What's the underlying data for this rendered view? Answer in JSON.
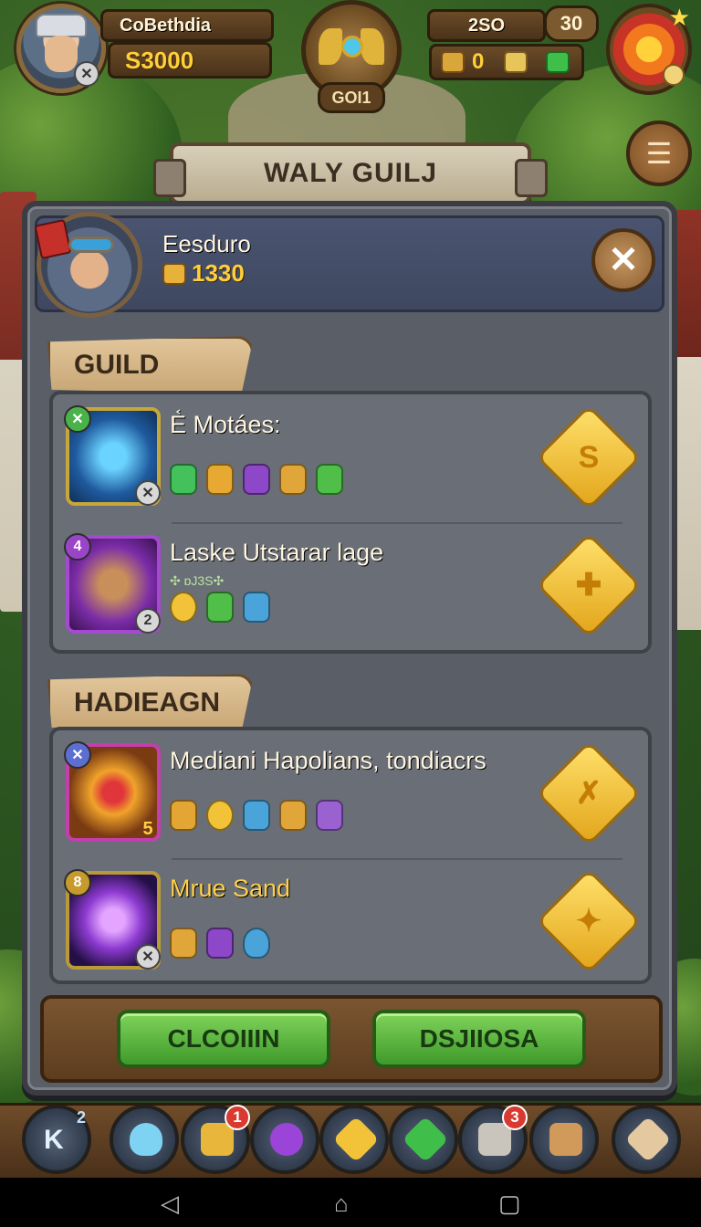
{
  "hud": {
    "player_name": "CoBethdia",
    "coins": "S3000",
    "emblem_label": "GOI1",
    "resource_top": "2SO",
    "resource_bottom": "0",
    "level": "30",
    "avatar_mini": "✕"
  },
  "title": "WALY GUILJ",
  "player": {
    "name": "Eesduro",
    "coins": "1330",
    "close_icon": "✕"
  },
  "sections": [
    {
      "tag": "GUILD",
      "rows": [
        {
          "title": "E᷾ Motáes:",
          "subtitle": "",
          "badge": "✕",
          "level": "✕",
          "button_glyph": "S",
          "items": [
            "#44c15a",
            "#e7a932",
            "#8d47c9",
            "#e0a63a",
            "#4fbf4a"
          ]
        },
        {
          "title": "Laske Utstarar lage",
          "subtitle": "✣ ɒJ3S✣",
          "badge": "4",
          "level": "2",
          "button_glyph": "✚",
          "items": [
            "#f2c338",
            "#4fbf4a",
            "#4aa3d9"
          ]
        }
      ]
    },
    {
      "tag": "HADIEAGN",
      "rows": [
        {
          "title": "Mediani Hapolians, tondiacrs",
          "subtitle": "",
          "badge": "✕",
          "level": "5",
          "button_glyph": "✗",
          "items": [
            "#e3a634",
            "#f2c338",
            "#4aa3d9",
            "#e0a63a",
            "#9a62d1"
          ]
        },
        {
          "title": "Mrue Sand",
          "subtitle": "",
          "badge": "8",
          "level": "✕",
          "button_glyph": "✦",
          "items": [
            "#e0a63a",
            "#8d47c9",
            "#4aa3d9"
          ]
        }
      ]
    }
  ],
  "buttons": {
    "left": "CLCOIIIN",
    "right": "DSJIIOSA"
  },
  "nav": {
    "first_text": "K",
    "first_sup": "2",
    "badge_2": "1",
    "badge_6": "3"
  },
  "system": {
    "back": "◁",
    "home": "⌂",
    "recent": "▢"
  },
  "colors": {
    "green_button": "#5fb83f",
    "panel": "#5a5e66",
    "gold": "#ffcf3a"
  }
}
